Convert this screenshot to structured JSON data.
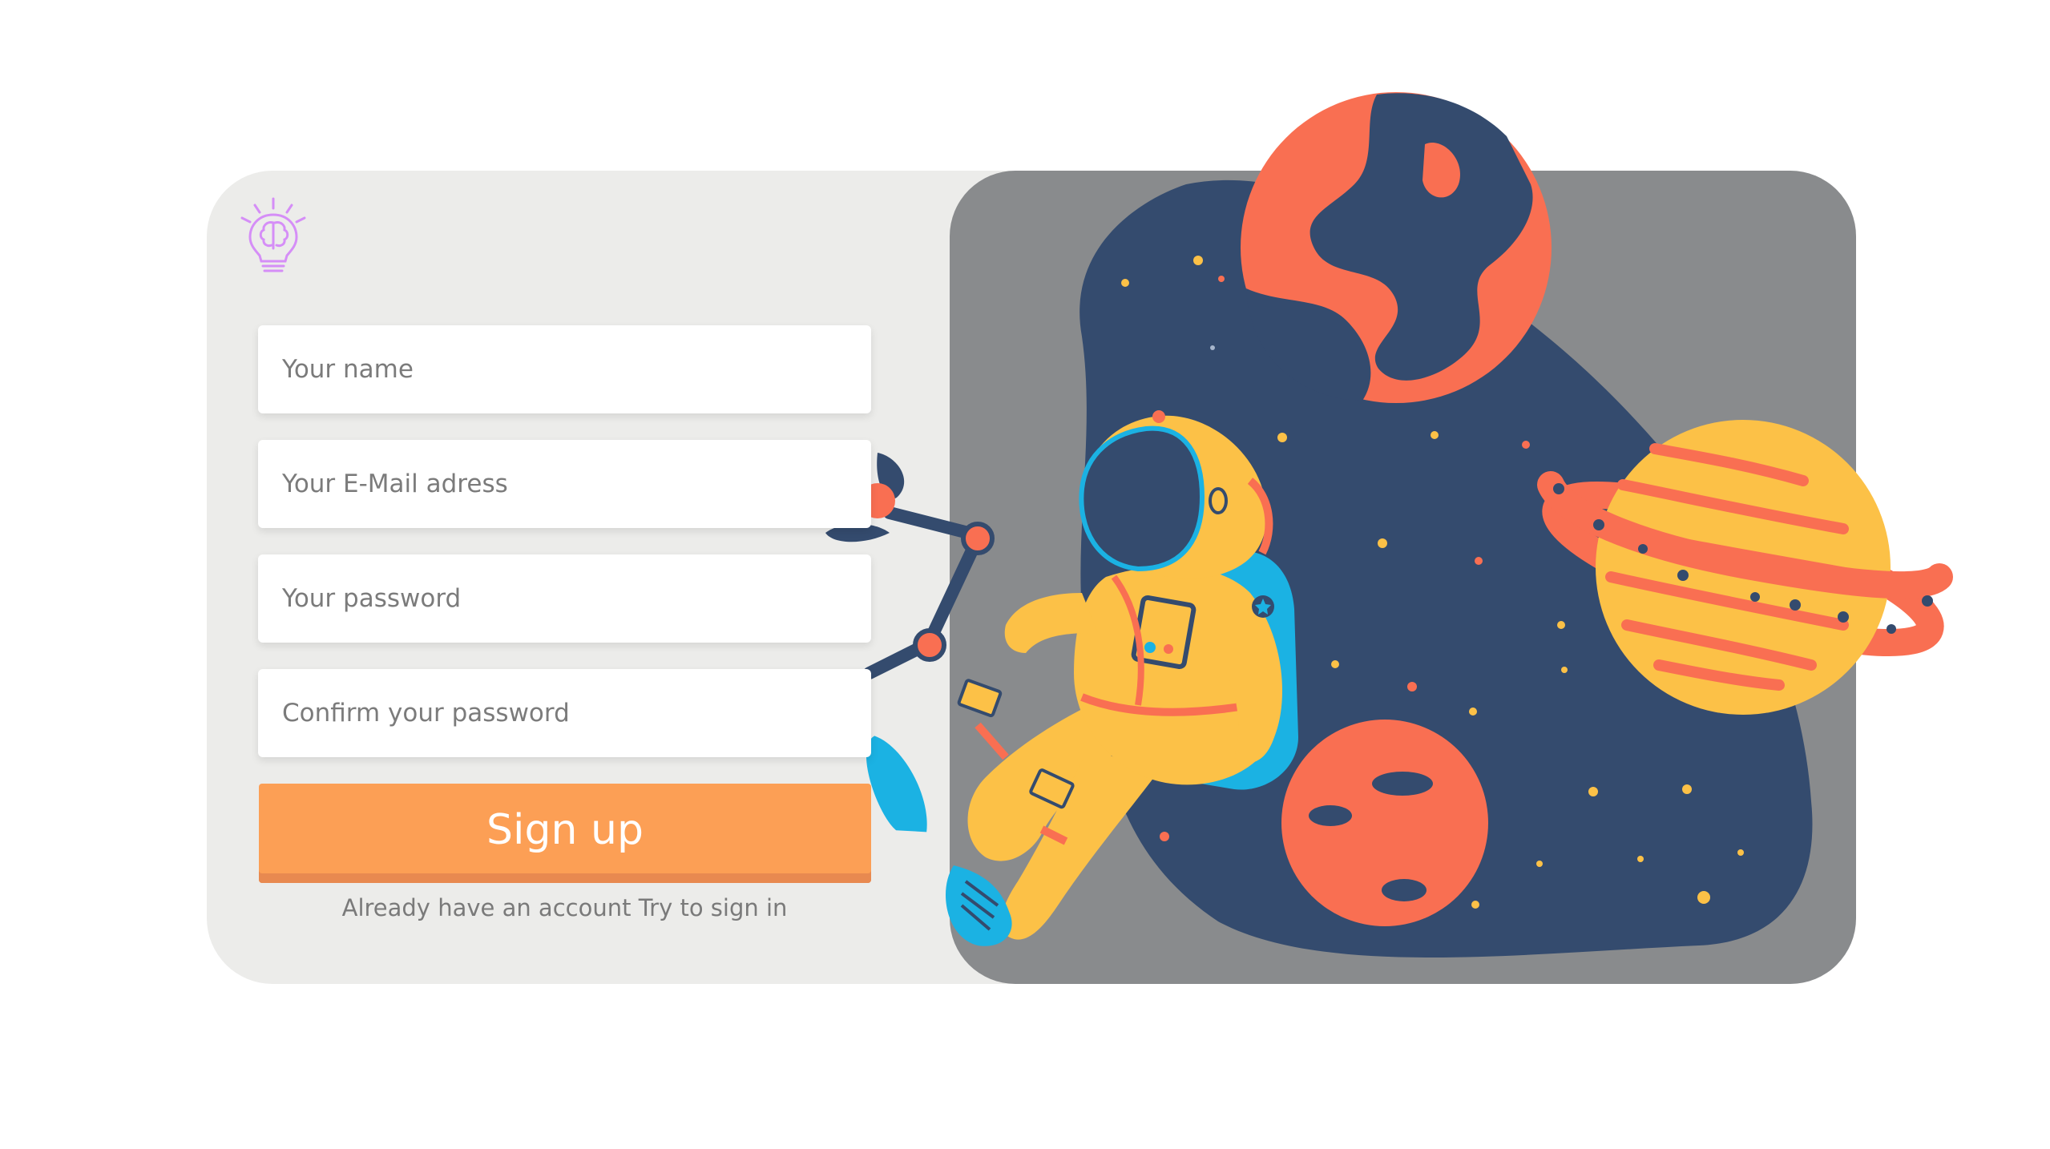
{
  "form": {
    "name_placeholder": "Your name",
    "email_placeholder": "Your E-Mail adress",
    "password_placeholder": "Your password",
    "confirm_placeholder": "Confirm your password",
    "submit_label": "Sign up",
    "signin_prefix": "Already have an account",
    "signin_link": "Try to sign in"
  },
  "icons": {
    "logo": "lightbulb-brain-icon"
  },
  "colors": {
    "card_background": "#ececea",
    "art_panel": "#898b8d",
    "blob_navy": "#344b6e",
    "accent_orange": "#fc9f55",
    "planet_coral": "#f96f52",
    "planet_yellow": "#fcc147",
    "logo_purple": "#d58ef7"
  }
}
